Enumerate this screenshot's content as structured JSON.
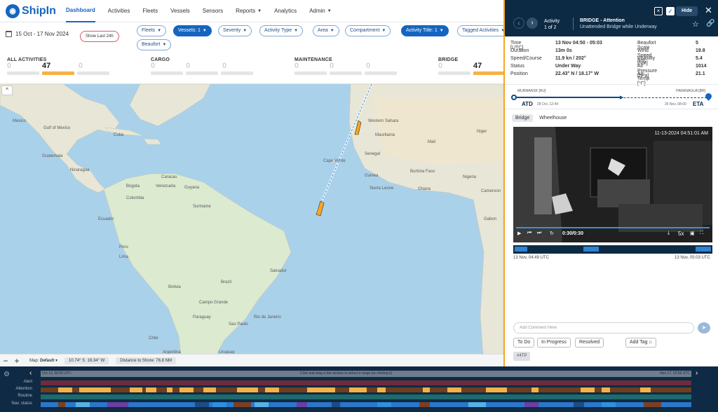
{
  "app": {
    "logo": "ShipIn"
  },
  "nav": {
    "items": [
      {
        "label": "Dashboard",
        "active": true,
        "caret": false
      },
      {
        "label": "Activities",
        "caret": false
      },
      {
        "label": "Fleets",
        "caret": false
      },
      {
        "label": "Vessels",
        "caret": false
      },
      {
        "label": "Sensors",
        "caret": false
      },
      {
        "label": "Reports",
        "caret": true
      },
      {
        "label": "Analytics",
        "caret": false
      },
      {
        "label": "Admin",
        "caret": true
      }
    ]
  },
  "filters": {
    "date_range": "15 Oct - 17 Nov 2024",
    "show_last": "Show Last 24h",
    "chips": [
      {
        "label": "Fleets",
        "active": false
      },
      {
        "label": "Vessels: 1",
        "active": true
      },
      {
        "label": "Severity",
        "active": false
      },
      {
        "label": "Activity Type",
        "active": false
      },
      {
        "label": "Area",
        "active": false
      },
      {
        "label": "Compartment",
        "active": false
      },
      {
        "label": "Activity Title: 1",
        "active": true
      },
      {
        "label": "Tagged Activities",
        "active": false
      },
      {
        "label": "Beaufort",
        "active": false
      }
    ]
  },
  "summary": {
    "categories": [
      {
        "title": "ALL ACTIVITIES",
        "counts": [
          "0",
          "47",
          "0"
        ]
      },
      {
        "title": "CARGO",
        "counts": [
          "0",
          "0",
          "0"
        ]
      },
      {
        "title": "MAINTENANCE",
        "counts": [
          "0",
          "0",
          "0"
        ]
      },
      {
        "title": "BRIDGE",
        "counts": [
          "0",
          "47",
          "0"
        ]
      }
    ]
  },
  "map": {
    "labels": [
      "Mexico",
      "Gulf of Mexico",
      "Cuba",
      "Guatemala",
      "Nicaragua",
      "Venezuela",
      "Colombia",
      "Guyana",
      "Suriname",
      "Ecuador",
      "Peru",
      "Brazil",
      "Bolivia",
      "Paraguay",
      "Chile",
      "Argentina",
      "Uruguay",
      "Western Sahara",
      "Mauritania",
      "Mali",
      "Niger",
      "Senegal",
      "Guinea",
      "Burkina Faso",
      "Nigeria",
      "Ghana",
      "Cameroon",
      "Gabon",
      "Sierra Leone",
      "Cape Verde",
      "Lima",
      "Rio de Janeiro",
      "Campo Grande",
      "Sao Paulo",
      "Salvador",
      "Bogota",
      "Caracas"
    ],
    "collapse_icon": "^",
    "zoom_out": "−",
    "zoom_in": "+",
    "map_type_label": "Map:",
    "map_type": "Default",
    "coord_lat": "10.74° S",
    "coord_lon": "19.34° W",
    "distance": "Distance to Shore: 76.8 NM"
  },
  "panel": {
    "activity_label": "Activity",
    "activity_index": "1 of 2",
    "title": "BRIDGE - Attention",
    "subtitle": "Unattended Bridge while Underway",
    "hide": "Hide",
    "metrics": [
      {
        "k": "Time [UTC]",
        "v": "13 Nov 04:50 - 05:03",
        "k2": "Beaufort Scale",
        "v2": "5"
      },
      {
        "k": "Duration",
        "v": "13m 0s",
        "k2": "Wind Speed [kn]",
        "v2": "19.8"
      },
      {
        "k": "Speed/Course",
        "v": "11.9 kn / 202°",
        "k2": "Visibility [NM]",
        "v2": "5.4"
      },
      {
        "k": "Status",
        "v": "Under Way",
        "k2": "Air Pressure [hPa]",
        "v2": "1014"
      },
      {
        "k": "Position",
        "v": "22.43° N / 18.17° W",
        "k2": "Air Temp [°C]",
        "v2": "21.1"
      }
    ],
    "route": {
      "from": "MURMANSK [RU]",
      "to": "PARANAGUA [BR]",
      "atd": "ATD",
      "atd_date": "28 Oct, 12:44",
      "eta": "ETA",
      "eta_date": "25 Nov, 08:00"
    },
    "tabs": [
      "Bridge",
      "Wheelhouse"
    ],
    "video": {
      "timestamp": "11-13-2024 04:51:01 AM",
      "time": "0:30/0:30",
      "speed": "5x",
      "progress": 1.0
    },
    "scrub_start": "13 Nov, 04:49 UTC",
    "scrub_end": "13 Nov, 05:03 UTC",
    "comment_placeholder": "Add Comment Here",
    "status_buttons": [
      "To Do",
      "In Progress",
      "Resolved",
      "Add Tag"
    ],
    "tag": "#4TP"
  },
  "timeline": {
    "start": "Oct 13, 00:00 UTC",
    "hint": "Click and drag a bar section to select a range (or clicking it)",
    "end": "Nov 17, 23:59 UTC",
    "rows": [
      "Alert",
      "Attention",
      "Routine",
      "Nav. status"
    ],
    "colors": {
      "alert": "#6b2c3c",
      "attention": "#f6b245",
      "routine": "#1e6a6e",
      "nav": "#2b77c9"
    }
  }
}
